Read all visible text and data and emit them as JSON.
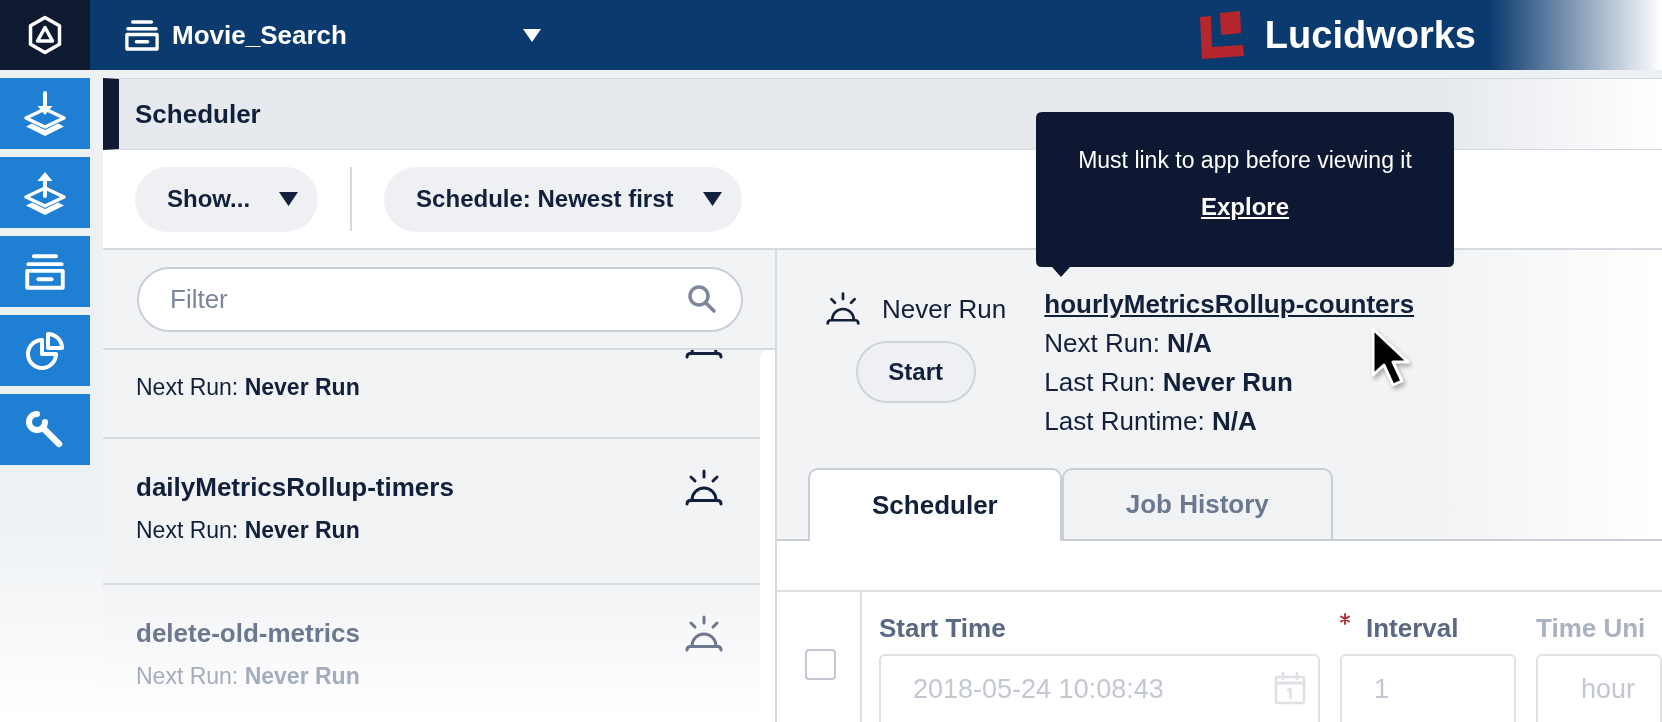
{
  "top_bar": {
    "app_name": "Movie_Search",
    "brand": "Lucidworks"
  },
  "panel": {
    "title": "Scheduler"
  },
  "toolbar": {
    "dropdowns": [
      {
        "label": "Show..."
      },
      {
        "label": "Schedule: Newest first"
      }
    ]
  },
  "job_list": {
    "filter": {
      "placeholder": "Filter"
    },
    "items": [
      {
        "next_run": "Next Run: **Never Run**"
      },
      {
        "name": "dailyMetricsRollup-timers",
        "next_run": "Next Run: **Never Run**"
      },
      {
        "name": "delete-old-metrics",
        "next_run": "Next Run: **Never Run**"
      }
    ]
  },
  "job_detail": {
    "status": "Never Run",
    "start_button": "Start",
    "name": "hourlyMetricsRollup-counters",
    "details": [
      "Next Run: **N/A**",
      "Last Run: **Never Run**",
      "Last Runtime: **N/A**"
    ]
  },
  "tooltip": {
    "message": "Must link to app before viewing it",
    "link": "Explore"
  },
  "tabs": [
    {
      "label": "Scheduler",
      "selected": true
    },
    {
      "label": "Job History",
      "selected": false
    }
  ],
  "schedule": {
    "rows": [
      {
        "checked": false,
        "fields": [
          {
            "kind": "datetime",
            "label": "Start Time",
            "required": false,
            "value": "2018-05-24 10:08:43",
            "disabled": true
          },
          {
            "kind": "number",
            "label": "Interval",
            "required": true,
            "value": "1",
            "disabled": true
          },
          {
            "kind": "select",
            "label": "Time Uni",
            "required": false,
            "value": "hour",
            "disabled": true
          }
        ]
      }
    ]
  }
}
